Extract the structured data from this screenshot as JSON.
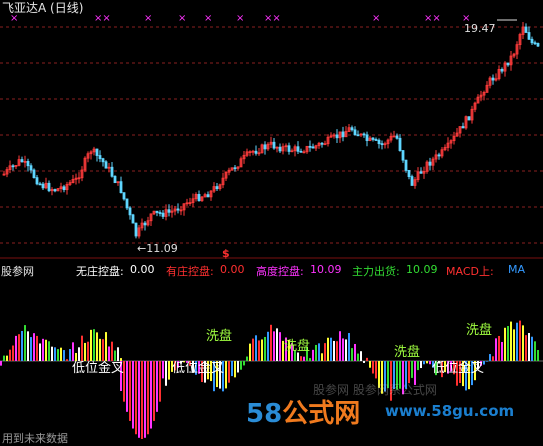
{
  "title": "飞亚达A (日线)",
  "price_high_label": "19.47",
  "price_low_label": "←11.09",
  "signal_char": "$",
  "top_marks": [
    "×",
    "××",
    "×",
    "×",
    "×",
    "×",
    "××",
    "×",
    "××",
    "×"
  ],
  "indicator": {
    "source": "股参网",
    "items": [
      {
        "label": "无庄控盘:",
        "value": "0.00",
        "color": "#ffffff"
      },
      {
        "label": "有庄控盘:",
        "value": "0.00",
        "color": "#ff3030"
      },
      {
        "label": "高度控盘:",
        "value": "10.09",
        "color": "#ff33ff"
      },
      {
        "label": "主力出货:",
        "value": "10.09",
        "color": "#33dd33"
      },
      {
        "label": "MACD上:",
        "value": "",
        "color": "#ff3030"
      },
      {
        "label": "MA",
        "value": "",
        "color": "#3399ff"
      }
    ]
  },
  "chart_labels": [
    "低位金叉",
    "低位金叉",
    "洗盘",
    "洗盘",
    "洗盘",
    "洗盘",
    "低位金叉"
  ],
  "watermark": {
    "num": "58",
    "word": "公式网",
    "url": "www.58gu.com",
    "cn": "股参网 股参网系公式网"
  },
  "footer": "用到未来数据",
  "colors": {
    "background": "#000000",
    "up_candle": "#ff3b3b",
    "down_candle": "#5fd6ff",
    "grid": "#8a1f1f"
  }
}
